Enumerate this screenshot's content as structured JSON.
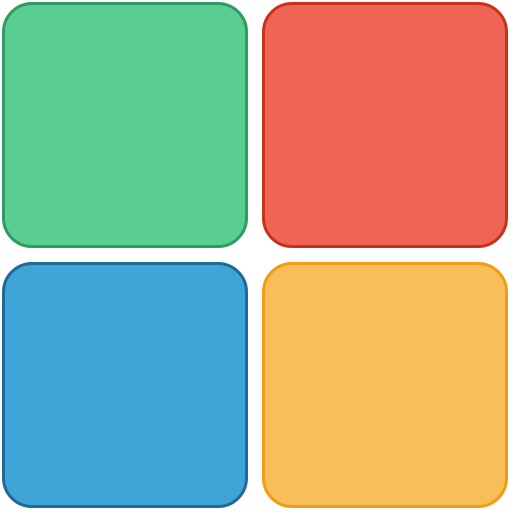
{
  "tiles": [
    {
      "id": "tile-tl",
      "color": "green",
      "fill": "#5ACD91",
      "border": "#2E9C62"
    },
    {
      "id": "tile-tr",
      "color": "red",
      "fill": "#F06455",
      "border": "#C7321F"
    },
    {
      "id": "tile-bl",
      "color": "blue",
      "fill": "#3FA4D8",
      "border": "#1E6C96"
    },
    {
      "id": "tile-br",
      "color": "yellow",
      "fill": "#F8BE5A",
      "border": "#EE9E12"
    }
  ]
}
